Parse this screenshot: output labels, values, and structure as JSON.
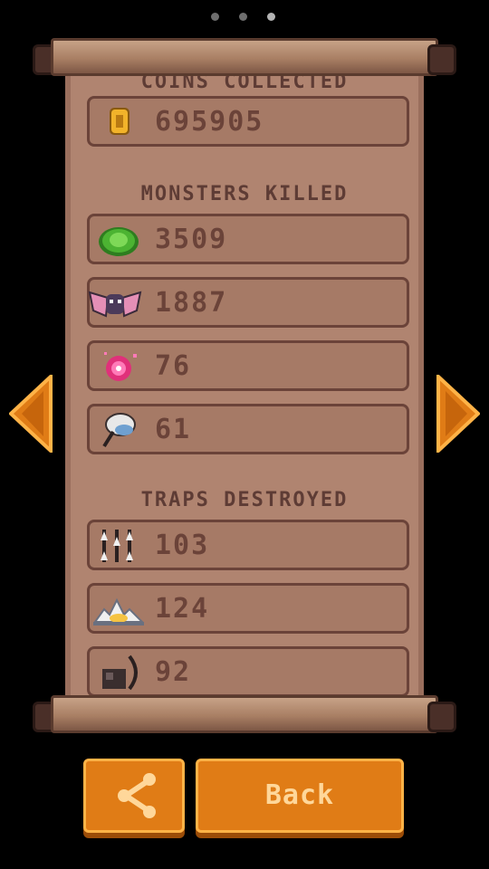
{
  "pager": {
    "count": 3,
    "active": 2
  },
  "sections": {
    "coins_title": "COINS COLLECTED",
    "monsters_title": "MONSTERS KILLED",
    "traps_title": "TRAPS DESTROYED"
  },
  "coins": {
    "icon": "gold-coin-icon",
    "value": "695905"
  },
  "monsters": [
    {
      "icon": "green-slime-icon",
      "value": "3509"
    },
    {
      "icon": "bat-icon",
      "value": "1887"
    },
    {
      "icon": "pink-wisp-icon",
      "value": "76"
    },
    {
      "icon": "ghost-mace-icon",
      "value": "61"
    }
  ],
  "traps": [
    {
      "icon": "spike-trap-icon",
      "value": "103"
    },
    {
      "icon": "saw-blade-trap-icon",
      "value": "124"
    },
    {
      "icon": "crossbow-trap-icon",
      "value": "92"
    }
  ],
  "buttons": {
    "back_label": "Back"
  },
  "colors": {
    "accent": "#e07c16",
    "paper": "#b08470",
    "text": "#6b4339"
  }
}
